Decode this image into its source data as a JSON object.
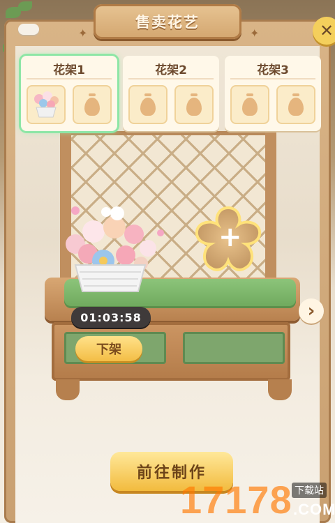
{
  "title": "售卖花艺",
  "close_icon": "close-icon",
  "shelves": [
    {
      "label": "花架1",
      "selected": true,
      "slots": [
        "flower-basket",
        "vase"
      ]
    },
    {
      "label": "花架2",
      "selected": false,
      "slots": [
        "vase",
        "vase"
      ]
    },
    {
      "label": "花架3",
      "selected": false,
      "slots": [
        "vase",
        "vase"
      ]
    }
  ],
  "timer": "01:03:58",
  "unshelf_label": "下架",
  "add_slot_icon": "plus-icon",
  "next_icon": "chevron-right-icon",
  "goto_craft_label": "前往制作",
  "watermark": {
    "big": "17178",
    "small": "下载站",
    "domain": ".COM"
  },
  "colors": {
    "accent": "#f3be46",
    "selected_glow": "#8ee6a6",
    "timer_bg": "#3f3a3a",
    "cushion": "#7ab468"
  }
}
